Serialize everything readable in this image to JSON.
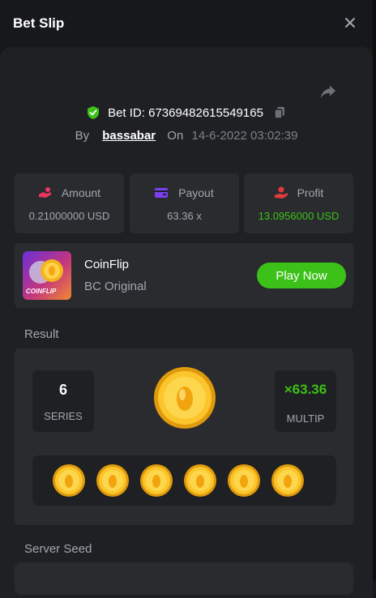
{
  "header": {
    "title": "Bet Slip"
  },
  "bet": {
    "id_label": "Bet ID: 67369482615549165",
    "by_label": "By",
    "username": "bassabar",
    "on_label": "On",
    "date": "14-6-2022 03:02:39"
  },
  "stats": [
    {
      "label": "Amount",
      "value": "0.21000000 USD",
      "icon": "hand-coin-icon",
      "icon_color": "#ea3560",
      "value_color": "#a3a6ad"
    },
    {
      "label": "Payout",
      "value": "63.36 x",
      "icon": "wallet-card-icon",
      "icon_color": "#7b3ff2",
      "value_color": "#a3a6ad"
    },
    {
      "label": "Profit",
      "value": "13.0956000 USD",
      "icon": "hand-profit-icon",
      "icon_color": "#e23b3b",
      "value_color": "#3bc117"
    }
  ],
  "game": {
    "name": "CoinFlip",
    "subtitle": "BC Original",
    "thumb_text": "COINFLIP",
    "play_label": "Play Now"
  },
  "result": {
    "label": "Result",
    "series_value": "6",
    "series_label": "SERIES",
    "multiplier_value": "×63.36",
    "multiplier_label": "MULTIP",
    "coin_count": 6
  },
  "server_seed": {
    "label": "Server Seed"
  },
  "colors": {
    "accent_green": "#3bc117",
    "shield_green": "#3bc117",
    "panel": "#1f2023",
    "card": "#2a2b2f"
  }
}
